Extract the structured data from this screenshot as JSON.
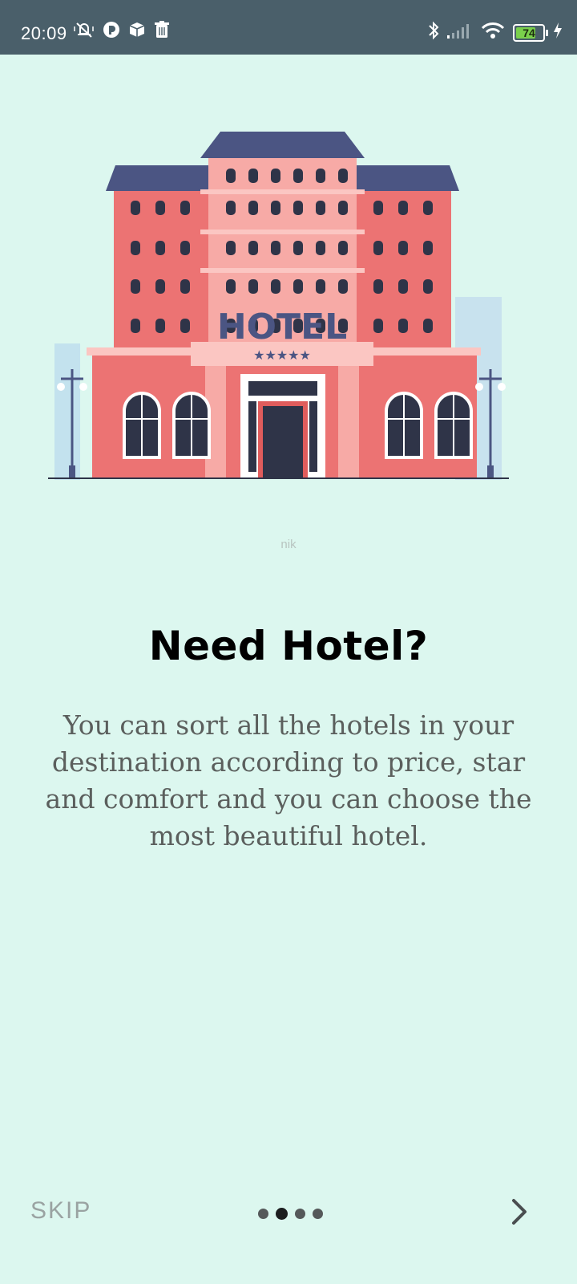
{
  "status_bar": {
    "time": "20:09",
    "battery_level": "74",
    "left_icons": [
      "mute-vibrate-icon",
      "app-notification-icon",
      "package-icon",
      "trash-icon"
    ],
    "right_icons": [
      "bluetooth-icon",
      "signal-icon",
      "wifi-icon",
      "battery-icon",
      "charging-icon"
    ]
  },
  "onboarding": {
    "illustration_sign": "HOTEL",
    "illustration_stars": "★★★★★",
    "image_credit": "nik",
    "title": "Need Hotel?",
    "description": "You can sort all the hotels in your destination according to price, star and comfort and you can choose the most beautiful hotel."
  },
  "navigation": {
    "skip_label": "SKIP",
    "page_count": 4,
    "active_page": 2,
    "next_icon": "chevron-right-icon"
  },
  "colors": {
    "background": "#dcf7ef",
    "status_bar": "#4a5f6a",
    "building_red": "#ec7373",
    "building_pink": "#f7aaa6",
    "roof_navy": "#4b5583",
    "text_dark": "#000000",
    "text_body": "#5b5f5d"
  }
}
